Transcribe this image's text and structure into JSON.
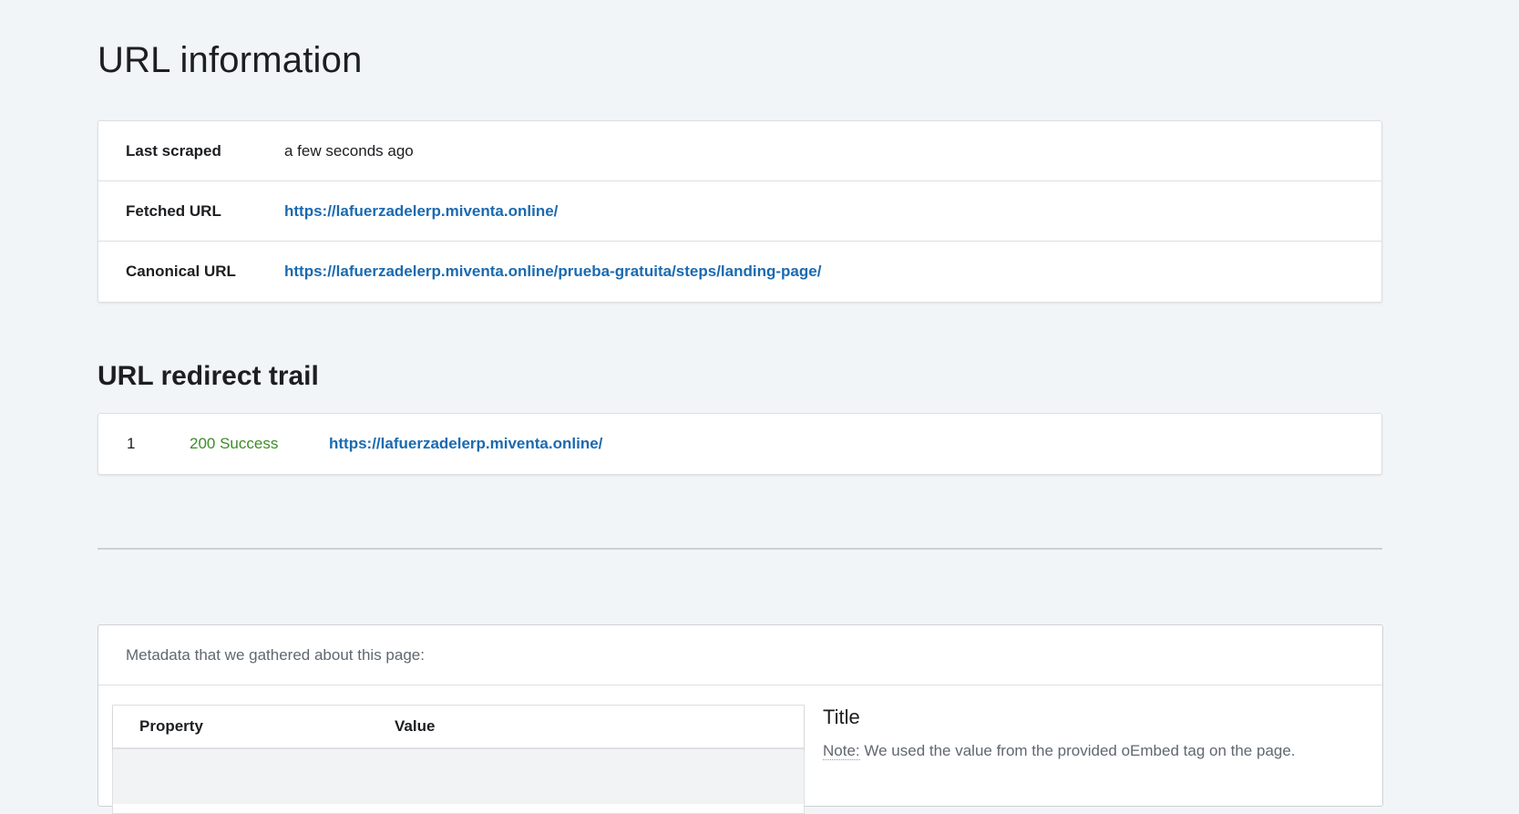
{
  "url_information": {
    "title": "URL information",
    "rows": [
      {
        "label": "Last scraped",
        "value": "a few seconds ago",
        "is_link": false
      },
      {
        "label": "Fetched URL",
        "value": "https://lafuerzadelerp.miventa.online/",
        "is_link": true
      },
      {
        "label": "Canonical URL",
        "value": "https://lafuerzadelerp.miventa.online/prueba-gratuita/steps/landing-page/",
        "is_link": true
      }
    ]
  },
  "redirect_trail": {
    "title": "URL redirect trail",
    "entries": [
      {
        "index": "1",
        "status": "200 Success",
        "url": "https://lafuerzadelerp.miventa.online/"
      }
    ]
  },
  "metadata": {
    "intro": "Metadata that we gathered about this page:",
    "table": {
      "property_header": "Property",
      "value_header": "Value"
    },
    "side": {
      "title": "Title",
      "note_label": "Note:",
      "note_text": " We used the value from the provided oEmbed tag on the page."
    }
  },
  "colors": {
    "link": "#1b6ab0",
    "success": "#3d8c28",
    "background": "#f2f5f8"
  }
}
